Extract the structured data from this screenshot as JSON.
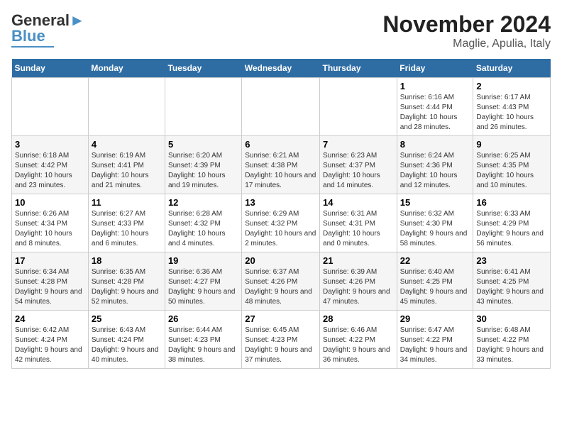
{
  "logo": {
    "text1": "General",
    "text2": "Blue"
  },
  "title": "November 2024",
  "subtitle": "Maglie, Apulia, Italy",
  "days_of_week": [
    "Sunday",
    "Monday",
    "Tuesday",
    "Wednesday",
    "Thursday",
    "Friday",
    "Saturday"
  ],
  "weeks": [
    [
      {
        "day": "",
        "info": ""
      },
      {
        "day": "",
        "info": ""
      },
      {
        "day": "",
        "info": ""
      },
      {
        "day": "",
        "info": ""
      },
      {
        "day": "",
        "info": ""
      },
      {
        "day": "1",
        "info": "Sunrise: 6:16 AM\nSunset: 4:44 PM\nDaylight: 10 hours and 28 minutes."
      },
      {
        "day": "2",
        "info": "Sunrise: 6:17 AM\nSunset: 4:43 PM\nDaylight: 10 hours and 26 minutes."
      }
    ],
    [
      {
        "day": "3",
        "info": "Sunrise: 6:18 AM\nSunset: 4:42 PM\nDaylight: 10 hours and 23 minutes."
      },
      {
        "day": "4",
        "info": "Sunrise: 6:19 AM\nSunset: 4:41 PM\nDaylight: 10 hours and 21 minutes."
      },
      {
        "day": "5",
        "info": "Sunrise: 6:20 AM\nSunset: 4:39 PM\nDaylight: 10 hours and 19 minutes."
      },
      {
        "day": "6",
        "info": "Sunrise: 6:21 AM\nSunset: 4:38 PM\nDaylight: 10 hours and 17 minutes."
      },
      {
        "day": "7",
        "info": "Sunrise: 6:23 AM\nSunset: 4:37 PM\nDaylight: 10 hours and 14 minutes."
      },
      {
        "day": "8",
        "info": "Sunrise: 6:24 AM\nSunset: 4:36 PM\nDaylight: 10 hours and 12 minutes."
      },
      {
        "day": "9",
        "info": "Sunrise: 6:25 AM\nSunset: 4:35 PM\nDaylight: 10 hours and 10 minutes."
      }
    ],
    [
      {
        "day": "10",
        "info": "Sunrise: 6:26 AM\nSunset: 4:34 PM\nDaylight: 10 hours and 8 minutes."
      },
      {
        "day": "11",
        "info": "Sunrise: 6:27 AM\nSunset: 4:33 PM\nDaylight: 10 hours and 6 minutes."
      },
      {
        "day": "12",
        "info": "Sunrise: 6:28 AM\nSunset: 4:32 PM\nDaylight: 10 hours and 4 minutes."
      },
      {
        "day": "13",
        "info": "Sunrise: 6:29 AM\nSunset: 4:32 PM\nDaylight: 10 hours and 2 minutes."
      },
      {
        "day": "14",
        "info": "Sunrise: 6:31 AM\nSunset: 4:31 PM\nDaylight: 10 hours and 0 minutes."
      },
      {
        "day": "15",
        "info": "Sunrise: 6:32 AM\nSunset: 4:30 PM\nDaylight: 9 hours and 58 minutes."
      },
      {
        "day": "16",
        "info": "Sunrise: 6:33 AM\nSunset: 4:29 PM\nDaylight: 9 hours and 56 minutes."
      }
    ],
    [
      {
        "day": "17",
        "info": "Sunrise: 6:34 AM\nSunset: 4:28 PM\nDaylight: 9 hours and 54 minutes."
      },
      {
        "day": "18",
        "info": "Sunrise: 6:35 AM\nSunset: 4:28 PM\nDaylight: 9 hours and 52 minutes."
      },
      {
        "day": "19",
        "info": "Sunrise: 6:36 AM\nSunset: 4:27 PM\nDaylight: 9 hours and 50 minutes."
      },
      {
        "day": "20",
        "info": "Sunrise: 6:37 AM\nSunset: 4:26 PM\nDaylight: 9 hours and 48 minutes."
      },
      {
        "day": "21",
        "info": "Sunrise: 6:39 AM\nSunset: 4:26 PM\nDaylight: 9 hours and 47 minutes."
      },
      {
        "day": "22",
        "info": "Sunrise: 6:40 AM\nSunset: 4:25 PM\nDaylight: 9 hours and 45 minutes."
      },
      {
        "day": "23",
        "info": "Sunrise: 6:41 AM\nSunset: 4:25 PM\nDaylight: 9 hours and 43 minutes."
      }
    ],
    [
      {
        "day": "24",
        "info": "Sunrise: 6:42 AM\nSunset: 4:24 PM\nDaylight: 9 hours and 42 minutes."
      },
      {
        "day": "25",
        "info": "Sunrise: 6:43 AM\nSunset: 4:24 PM\nDaylight: 9 hours and 40 minutes."
      },
      {
        "day": "26",
        "info": "Sunrise: 6:44 AM\nSunset: 4:23 PM\nDaylight: 9 hours and 38 minutes."
      },
      {
        "day": "27",
        "info": "Sunrise: 6:45 AM\nSunset: 4:23 PM\nDaylight: 9 hours and 37 minutes."
      },
      {
        "day": "28",
        "info": "Sunrise: 6:46 AM\nSunset: 4:22 PM\nDaylight: 9 hours and 36 minutes."
      },
      {
        "day": "29",
        "info": "Sunrise: 6:47 AM\nSunset: 4:22 PM\nDaylight: 9 hours and 34 minutes."
      },
      {
        "day": "30",
        "info": "Sunrise: 6:48 AM\nSunset: 4:22 PM\nDaylight: 9 hours and 33 minutes."
      }
    ]
  ]
}
